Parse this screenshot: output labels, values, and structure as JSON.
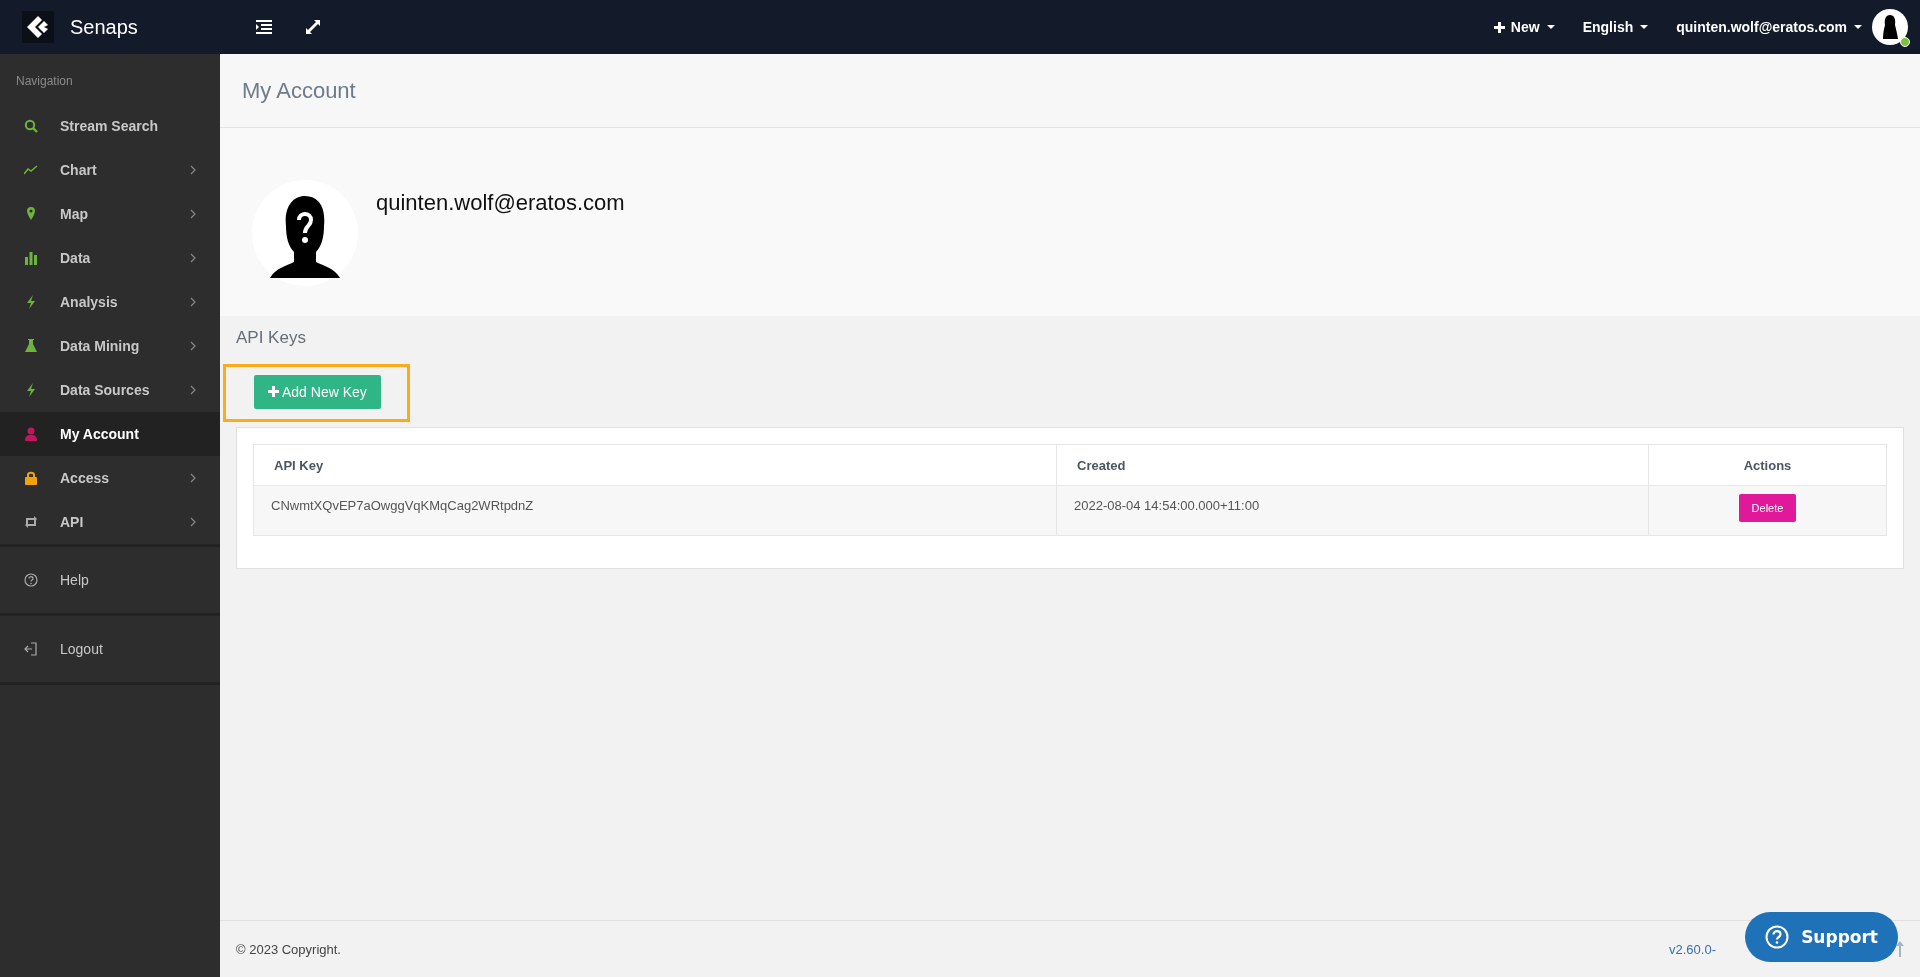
{
  "brand": {
    "name": "Senaps"
  },
  "topbar": {
    "new_menu": "New",
    "language_menu": "English",
    "user_menu": "quinten.wolf@eratos.com",
    "online": true
  },
  "sidebar": {
    "heading": "Navigation",
    "items": [
      {
        "label": "Stream Search",
        "has_children": false,
        "selected": false
      },
      {
        "label": "Chart",
        "has_children": true,
        "selected": false
      },
      {
        "label": "Map",
        "has_children": true,
        "selected": false
      },
      {
        "label": "Data",
        "has_children": true,
        "selected": false
      },
      {
        "label": "Analysis",
        "has_children": true,
        "selected": false
      },
      {
        "label": "Data Mining",
        "has_children": true,
        "selected": false
      },
      {
        "label": "Data Sources",
        "has_children": true,
        "selected": false
      },
      {
        "label": "My Account",
        "has_children": false,
        "selected": true
      },
      {
        "label": "Access",
        "has_children": true,
        "selected": false
      },
      {
        "label": "API",
        "has_children": true,
        "selected": false
      }
    ],
    "bottom_items": [
      {
        "label": "Help"
      },
      {
        "label": "Logout"
      }
    ]
  },
  "page": {
    "title": "My Account",
    "email": "quinten.wolf@eratos.com"
  },
  "api_keys": {
    "heading": "API Keys",
    "add_button": "Add New Key",
    "highlighted": true,
    "columns": [
      "API Key",
      "Created",
      "Actions"
    ],
    "rows": [
      {
        "key": "CNwmtXQvEP7aOwggVqKMqCag2WRtpdnZ",
        "created": "2022-08-04 14:54:00.000+11:00",
        "action": "Delete"
      }
    ]
  },
  "footer": {
    "copyright": "© 2023 Copyright.",
    "version": "v2.60.0-"
  },
  "support_button": "Support"
}
